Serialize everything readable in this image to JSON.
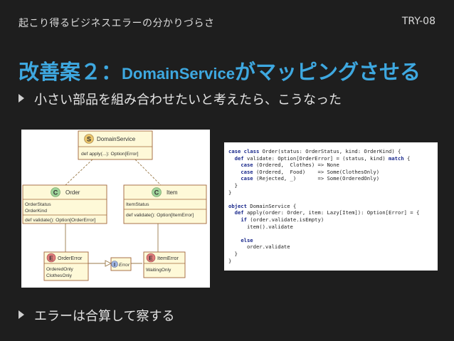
{
  "header": {
    "title": "起こり得るビジネスエラーの分かりづらさ",
    "code": "TRY-08"
  },
  "slide": {
    "title_prefix": "改善案２：",
    "title_mono": "DomainService",
    "title_suffix": "がマッピングさせる",
    "bullets": [
      "小さい部品を組み合わせたいと考えたら、こうなった",
      "エラーは合算して察する"
    ]
  },
  "uml": {
    "domain_service": {
      "stereotype": "S",
      "name": "DomainService",
      "method": "def apply(...): Option[Error]"
    },
    "order": {
      "stereotype": "C",
      "name": "Order",
      "fields": [
        "OrderStatus",
        "OrderKind"
      ],
      "method": "def validate(): Option[OrderError]"
    },
    "item": {
      "stereotype": "C",
      "name": "Item",
      "fields": [
        "ItemStatus"
      ],
      "method": "def validate(): Option[ItemError]"
    },
    "order_error": {
      "stereotype": "E",
      "name": "OrderError",
      "fields": [
        "OrderedOnly",
        "ClothesOnly"
      ]
    },
    "error": {
      "stereotype": "I",
      "name": "Error"
    },
    "item_error": {
      "stereotype": "E",
      "name": "ItemError",
      "fields": [
        "WaitingOnly"
      ]
    },
    "colors": {
      "stereotype_S": "#e9c46a",
      "stereotype_C": "#9fd39a",
      "stereotype_E": "#e07b7b",
      "stereotype_I": "#9fb4e0"
    }
  },
  "code": {
    "lines": [
      "case class Order(status: OrderStatus, kind: OrderKind) {",
      "  def validate: Option[OrderError] = (status, kind) match {",
      "    case (Ordered,  Clothes) => None",
      "    case (Ordered,  Food)    => Some(ClothesOnly)",
      "    case (Rejected, _)       => Some(OrderedOnly)",
      "  }",
      "}",
      "",
      "object DomainService {",
      "  def apply(order: Order, item: Lazy[Item]): Option[Error] = {",
      "    if (order.validate.isEmpty)",
      "      item().validate",
      "",
      "    else",
      "      order.validate",
      "  }",
      "}"
    ]
  }
}
